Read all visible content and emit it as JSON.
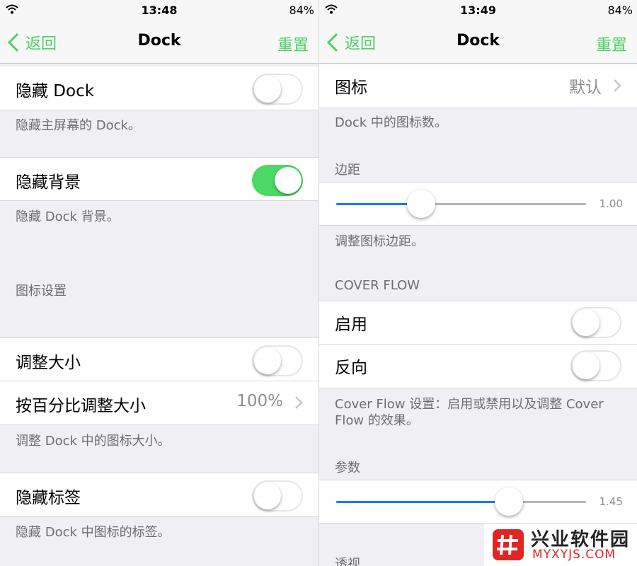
{
  "left": {
    "status": {
      "time": "13:48",
      "battery": "84%"
    },
    "nav": {
      "back": "返回",
      "title": "Dock",
      "reset": "重置"
    },
    "hide_dock": {
      "label": "隐藏 Dock",
      "on": false,
      "note": "隐藏主屏幕的 Dock。"
    },
    "hide_background": {
      "label": "隐藏背景",
      "on": true,
      "note": "隐藏 Dock 背景。"
    },
    "icon_settings_header": "图标设置",
    "resize": {
      "label": "调整大小",
      "on": false
    },
    "resize_percent": {
      "label": "按百分比调整大小",
      "value": "100%"
    },
    "resize_note": "调整 Dock 中的图标大小。",
    "hide_labels": {
      "label": "隐藏标签",
      "on": false,
      "note": "隐藏 Dock 中图标的标签。"
    }
  },
  "right": {
    "status": {
      "time": "13:49",
      "battery": "84%"
    },
    "nav": {
      "back": "返回",
      "title": "Dock",
      "reset": "重置"
    },
    "icons": {
      "label": "图标",
      "value": "默认",
      "note": "Dock 中的图标数。"
    },
    "spacing": {
      "header": "边距",
      "value": "1.00",
      "fraction": 0.34,
      "note": "调整图标边距。"
    },
    "cover_flow_header": "COVER FLOW",
    "enable": {
      "label": "启用",
      "on": false
    },
    "reverse": {
      "label": "反向",
      "on": false
    },
    "cover_flow_note": "Cover Flow 设置：启用或禁用以及调整 Cover Flow 的效果。",
    "params": {
      "header": "参数",
      "value": "1.45",
      "fraction": 0.69
    },
    "perspective_header": "透视"
  },
  "watermark": {
    "name": "兴业软件园",
    "domain": "MYXYJS.COM"
  },
  "colors": {
    "accent": "#4cd164",
    "toggle_on": "#4cd964",
    "slider": "#1a7ee5"
  },
  "icons": [
    "wifi-icon",
    "back-chevron-icon",
    "disclosure-chevron-icon"
  ]
}
